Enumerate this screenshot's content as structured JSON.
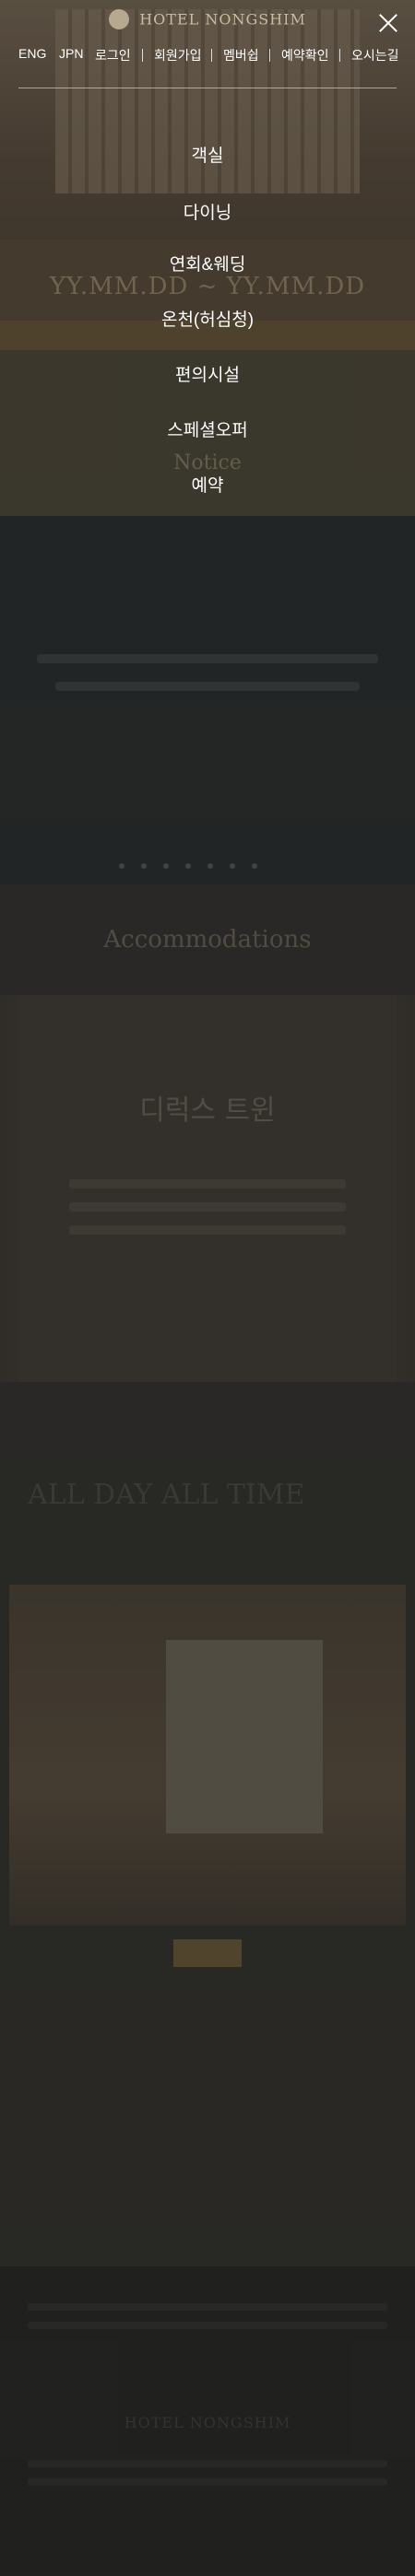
{
  "header": {
    "logo_name": "HOTEL NONGSHIM",
    "close_icon": "close-icon"
  },
  "topnav": [
    {
      "label": "ENG"
    },
    {
      "label": "JPN"
    },
    {
      "label": "로그인"
    },
    {
      "label": "회원가입"
    },
    {
      "label": "멤버쉽"
    },
    {
      "label": "예약확인"
    },
    {
      "label": "오시는길"
    }
  ],
  "menu": [
    {
      "label": "객실"
    },
    {
      "label": "다이닝"
    },
    {
      "label": "연회&웨딩"
    },
    {
      "label": "온천(허심청)"
    },
    {
      "label": "편의시설"
    },
    {
      "label": "스페셜오퍼"
    },
    {
      "label": "예약"
    }
  ],
  "background": {
    "date_range": "YY.MM.DD ~ YY.MM.DD",
    "notice": "Notice",
    "accommodations_title": "Accommodations",
    "accommodation_name": "디럭스 트윈",
    "all_day_title": "ALL DAY ALL TIME"
  },
  "colors": {
    "overlay": "#1e1e1c",
    "menu_text": "#ffffff",
    "brand": "#c9bca3"
  }
}
